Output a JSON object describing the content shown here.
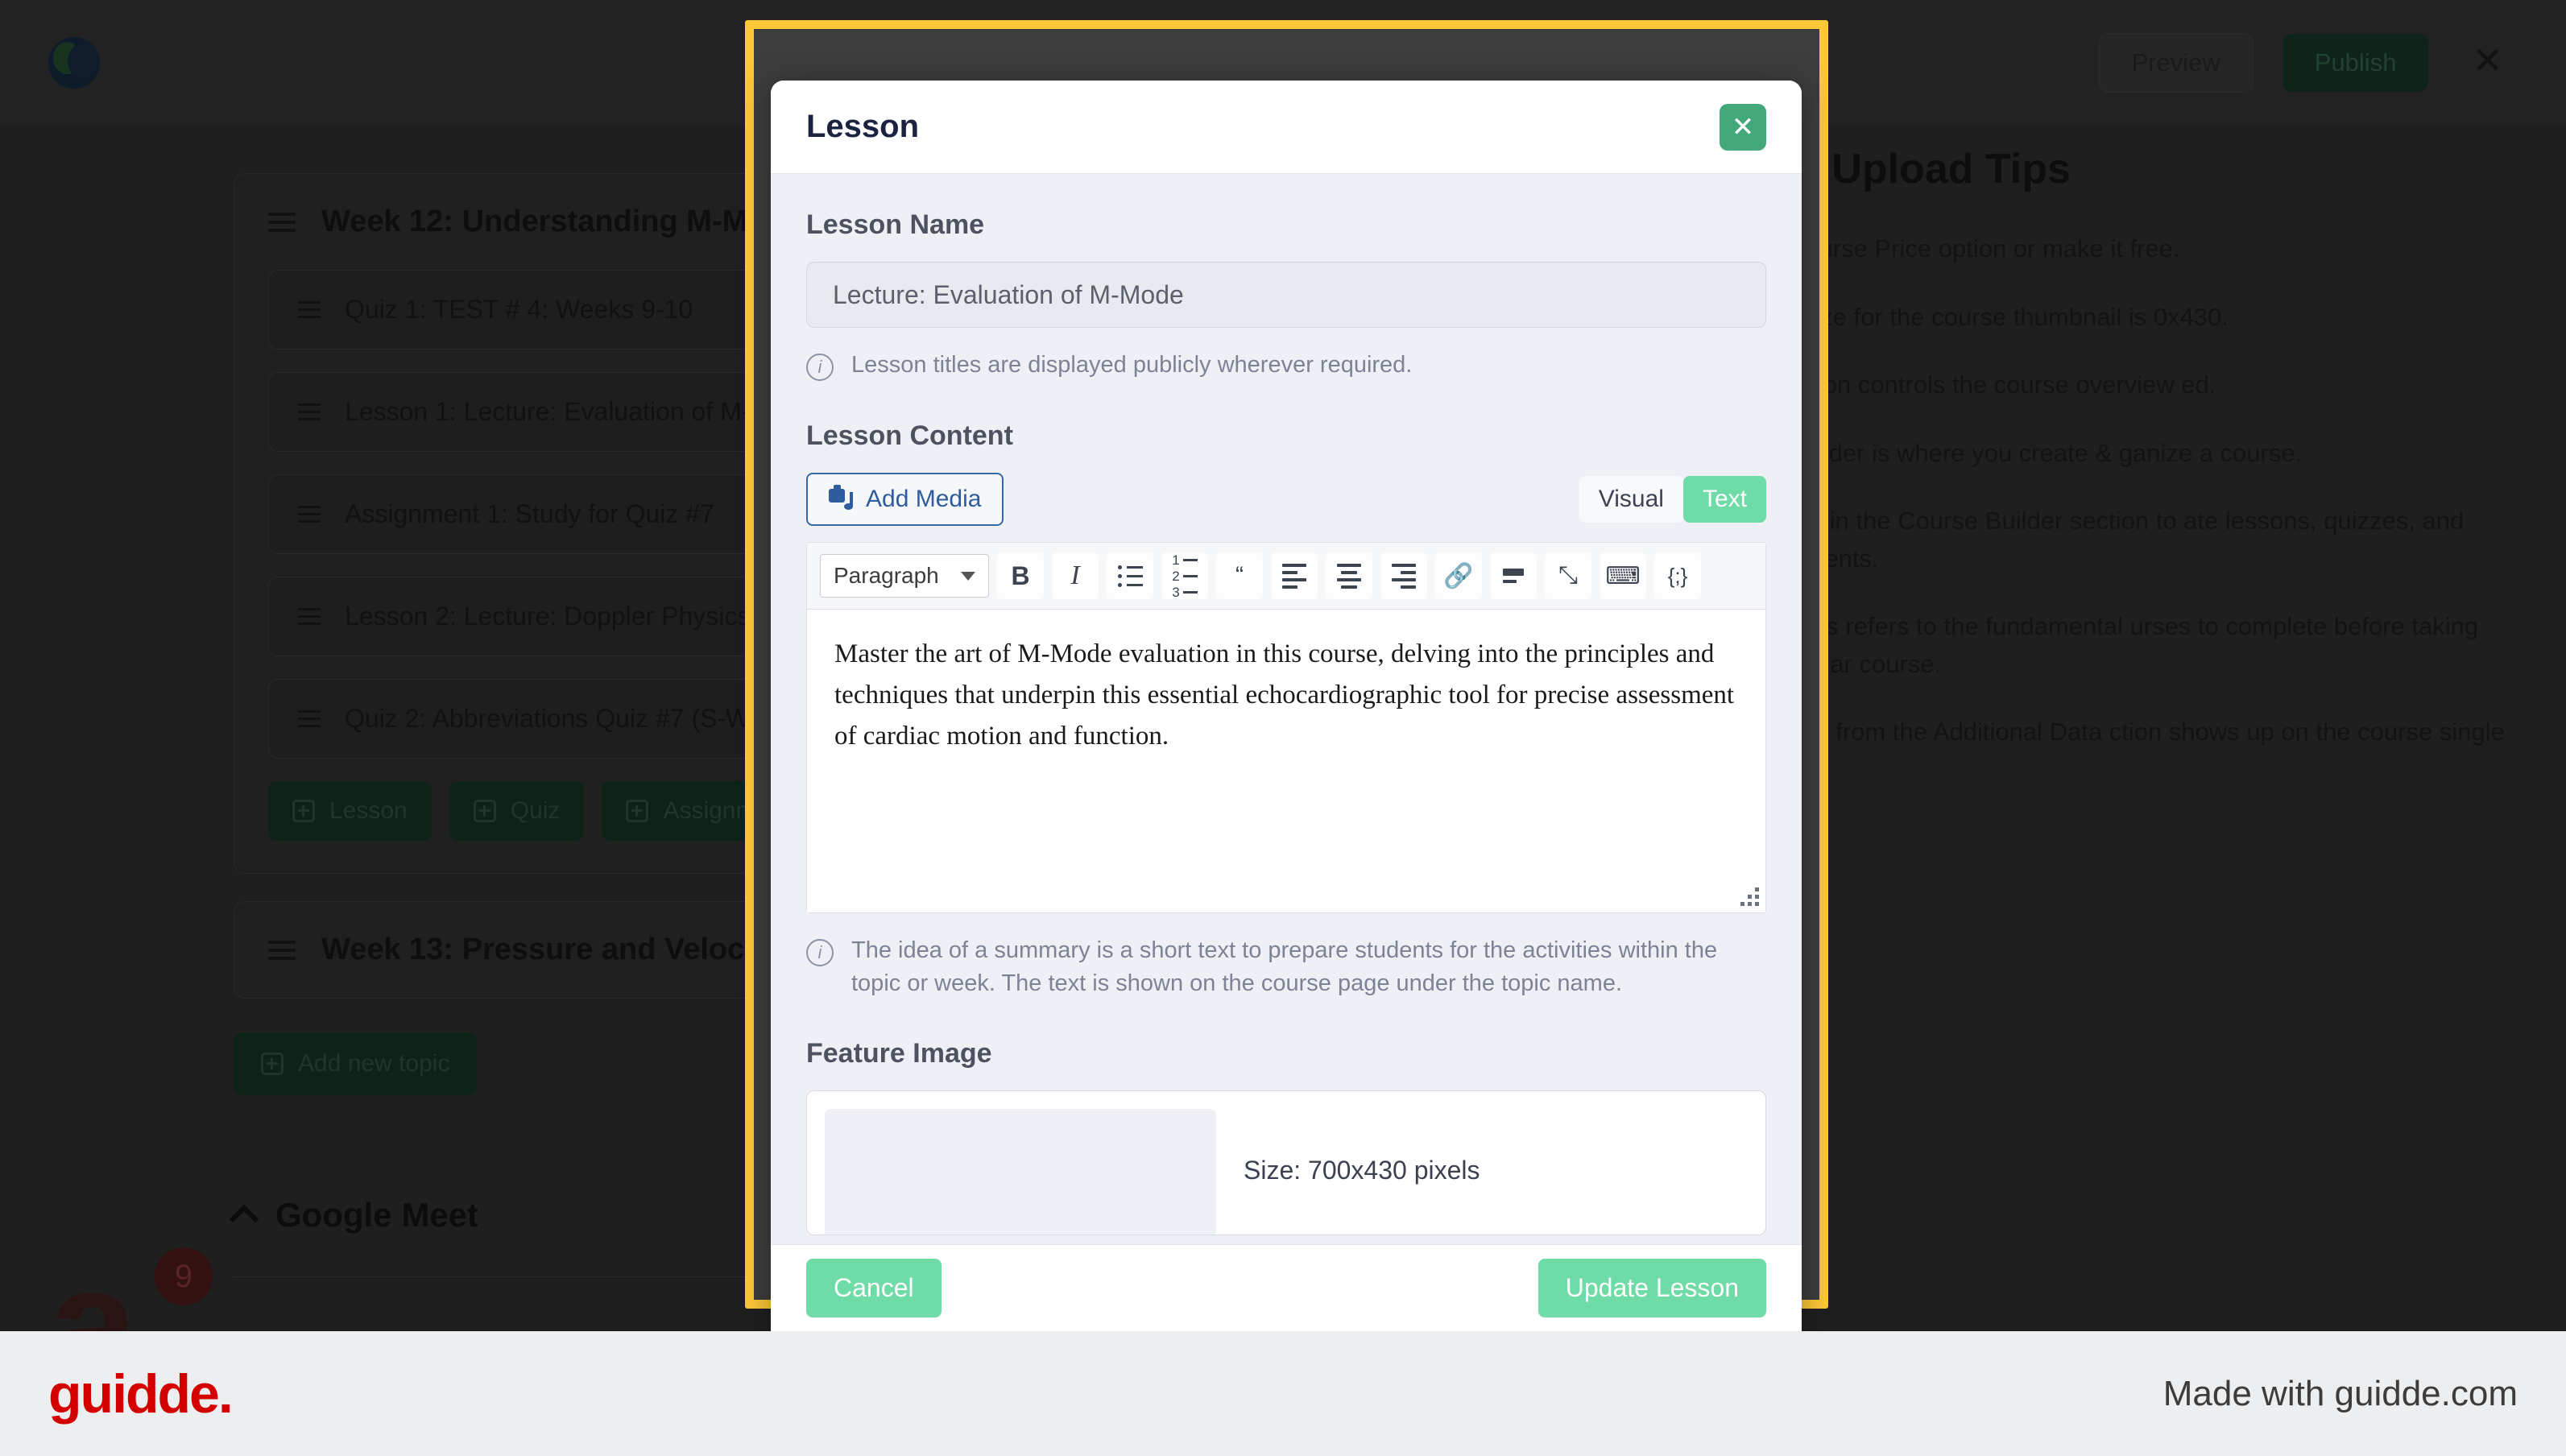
{
  "topbar": {
    "logo_name": "app-logo",
    "preview_label": "Preview",
    "publish_label": "Publish",
    "close_label": "✕"
  },
  "builder": {
    "topics": [
      {
        "title": "Week 12: Understanding M-Mode",
        "items": [
          "Quiz 1: TEST # 4: Weeks 9-10",
          "Lesson 1: Lecture: Evaluation of M-",
          "Assignment 1: Study for Quiz #7",
          "Lesson 2: Lecture: Doppler Physics",
          "Quiz 2: Abbreviations Quiz #7 (S-W"
        ],
        "add_buttons": [
          "Lesson",
          "Quiz",
          "Assignments"
        ]
      },
      {
        "title": "Week 13: Pressure and Velocity",
        "items": [],
        "add_buttons": []
      }
    ],
    "add_topic_label": "Add new topic"
  },
  "google_meet": {
    "title": "Google Meet"
  },
  "corner_mark": {
    "glyph": "a",
    "badge_count": "9"
  },
  "tips": {
    "title": "urse Upload Tips",
    "paragraphs": [
      ": the Course Price option or make it free.",
      "ndard size for the course thumbnail is 0x430.",
      "led section controls the course overview ed.",
      "urse Builder is where you create & ganize a course.",
      "d Topics in the Course Builder section to ate lessons, quizzes, and assignments.",
      "requisites refers to the fundamental urses to complete before taking this rticular course.",
      "ormation from the Additional Data ction shows up on the course single ge."
    ]
  },
  "modal": {
    "title": "Lesson",
    "close_label": "✕",
    "lesson_name": {
      "label": "Lesson Name",
      "value": "Lecture: Evaluation of M-Mode",
      "placeholder": "Lesson Name",
      "hint": "Lesson titles are displayed publicly wherever required."
    },
    "lesson_content": {
      "label": "Lesson Content",
      "add_media_label": "Add Media",
      "mode_visual": "Visual",
      "mode_text": "Text",
      "paragraph_select": "Paragraph",
      "toolbar_icons": [
        "bold-icon",
        "italic-icon",
        "bullet-list-icon",
        "numbered-list-icon",
        "blockquote-icon",
        "align-left-icon",
        "align-center-icon",
        "align-right-icon",
        "link-icon",
        "read-more-icon",
        "fullscreen-icon",
        "keyboard-shortcuts-icon",
        "code-icon"
      ],
      "body": "Master the art of M-Mode evaluation in this course, delving into the principles and techniques that underpin this essential echocardiographic tool for precise assessment of cardiac motion and function.",
      "hint": "The idea of a summary is a short text to prepare students for the activities within the topic or week. The text is shown on the course page under the topic name."
    },
    "feature_image": {
      "label": "Feature Image",
      "size_text": "Size: 700x430 pixels"
    },
    "footer": {
      "cancel_label": "Cancel",
      "update_label": "Update Lesson"
    }
  },
  "guidde": {
    "logo_text": "guidde.",
    "made_with": "Made with guidde.com"
  },
  "colors": {
    "highlight": "#fdc738",
    "accent_green": "#6fdba6",
    "close_green": "#44a97a",
    "brand_red": "#d40000",
    "link_blue": "#2e5c9e"
  }
}
